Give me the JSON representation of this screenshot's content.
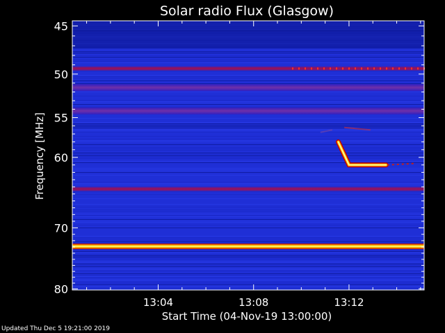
{
  "chart_data": {
    "type": "heatmap",
    "title": "Solar radio Flux (Glasgow)",
    "xlabel": "Start Time (04-Nov-19 13:00:00)",
    "ylabel": "Frequency [MHz]",
    "y_ticks": [
      45,
      50,
      55,
      60,
      70,
      80
    ],
    "y_tick_labels": [
      "45",
      "50",
      "55",
      "60",
      "70",
      "80"
    ],
    "y_scale": "log",
    "ylim": [
      44.5,
      80.2
    ],
    "x_ticks": [
      "13:04",
      "13:08",
      "13:12"
    ],
    "x_tick_minutes": [
      4,
      8,
      12
    ],
    "xlim_minutes": [
      0.4,
      15.15
    ],
    "background_color": "#1f2fd6",
    "persistent_bands_mhz": [
      {
        "freq": 49.4,
        "intensity": "medium"
      },
      {
        "freq": 51.5,
        "intensity": "low"
      },
      {
        "freq": 54.2,
        "intensity": "low"
      },
      {
        "freq": 64.3,
        "intensity": "medium"
      },
      {
        "freq": 72.9,
        "intensity": "high"
      }
    ],
    "burst": {
      "start_minute": 11.55,
      "end_minute": 13.55,
      "start_freq": 58.0,
      "end_freq": 61.0
    }
  },
  "footer": "Updated Thu Dec  5 19:21:00 2019"
}
